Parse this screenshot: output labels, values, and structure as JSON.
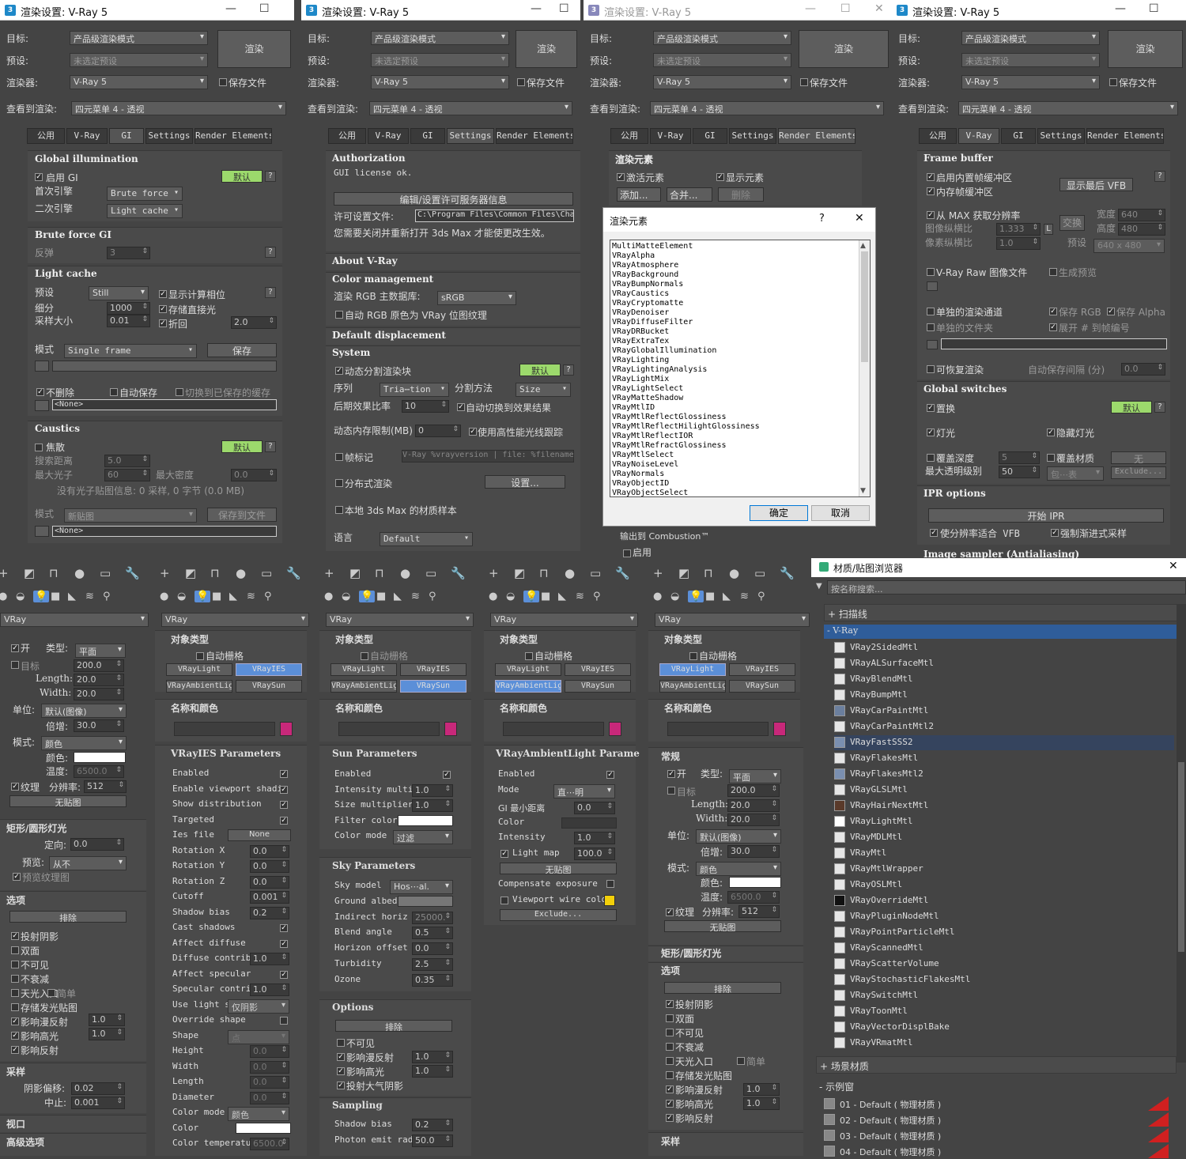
{
  "windows": [
    {
      "title": "渲染设置: V-Ray 5",
      "target_label": "目标:",
      "target": "产品级渲染模式",
      "preset_label": "预设:",
      "preset": "未选定预设",
      "renderer_label": "渲染器:",
      "renderer": "V-Ray 5",
      "save_file": "保存文件",
      "view_label": "查看到渲染:",
      "view": "四元菜单 4 - 透视",
      "render_btn": "渲染"
    }
  ],
  "tabs": [
    "公用",
    "V-Ray",
    "GI",
    "Settings",
    "Render Elements"
  ],
  "gi": {
    "global_title": "Global illumination",
    "enable_gi": "启用 GI",
    "default_btn": "默认",
    "primary": "首次引擎",
    "primary_val": "Brute force",
    "secondary": "二次引擎",
    "secondary_val": "Light cache",
    "bf_title": "Brute force GI",
    "bounces": "反弹",
    "bounces_val": "3",
    "lc_title": "Light cache",
    "preset": "预设",
    "preset_val": "Still",
    "show_phase": "显示计算相位",
    "subdiv": "细分",
    "subdiv_val": "1000",
    "store_direct": "存储直接光",
    "sample_size": "采样大小",
    "sample_val": "0.01",
    "retrace": "折回",
    "retrace_val": "2.0",
    "mode": "模式",
    "mode_val": "Single frame",
    "save": "保存",
    "dont_delete": "不删除",
    "auto_save": "自动保存",
    "switch_saved": "切换到已保存的缓存",
    "none": "<None>",
    "caustics_title": "Caustics",
    "focus": "焦散",
    "search_dist": "搜索距离",
    "search_val": "5.0",
    "max_photons": "最大光子",
    "max_photons_val": "60",
    "max_density": "最大密度",
    "max_density_val": "0.0",
    "no_map": "没有光子贴图信息: 0 采样, 0 字节 (0.0 MB)",
    "mode2": "模式",
    "new_map": "新贴图",
    "save_file": "保存到文件",
    "none2": "<None>"
  },
  "settings": {
    "auth_title": "Authorization",
    "license_ok": "GUI license ok.",
    "edit_license": "编辑/设置许可服务器信息",
    "license_file": "许可设置文件:",
    "license_path": "C:\\Program Files\\Common Files\\Cha",
    "restart_note": "您需要关闭并重新打开 3ds Max 才能使更改生效。",
    "about": "About V-Ray",
    "color_mgmt": "Color management",
    "rgb_label": "渲染 RGB 主数据库:",
    "rgb_val": "sRGB",
    "auto_rgb": "自动 RGB 原色为 VRay 位图纹理",
    "default_disp": "Default displacement",
    "system": "System",
    "dyn_split": "动态分割渲染块",
    "default_btn": "默认",
    "seq": "序列",
    "seq_val": "Tria⋯tion",
    "split_method": "分割方法",
    "split_val": "Size",
    "post_ratio": "后期效果比率",
    "post_val": "10",
    "auto_switch": "自动切换到效果结果",
    "dyn_mem": "动态内存限制(MB)",
    "dyn_mem_val": "0",
    "use_hp": "使用高性能光线跟踪",
    "frame_stamp": "帧标记",
    "stamp_val": "V-Ray %vrayversion | file: %filename",
    "dist_render": "分布式渲染",
    "setup": "设置...",
    "local_mat": "本地 3ds Max 的材质样本",
    "lang": "语言",
    "lang_val": "Default"
  },
  "elements": {
    "title": "渲染元素",
    "active": "激活元素",
    "show": "显示元素",
    "add": "添加...",
    "merge": "合并...",
    "delete": "删除",
    "output_combustion": "输出到 Combustion™",
    "enable": "启用",
    "dialog_title": "渲染元素",
    "dialog_q": "?",
    "ok": "确定",
    "cancel": "取消",
    "list": [
      "MultiMatteElement",
      "VRayAlpha",
      "VRayAtmosphere",
      "VRayBackground",
      "VRayBumpNormals",
      "VRayCaustics",
      "VRayCryptomatte",
      "VRayDenoiser",
      "VRayDiffuseFilter",
      "VRayDRBucket",
      "VRayExtraTex",
      "VRayGlobalIllumination",
      "VRayLighting",
      "VRayLightingAnalysis",
      "VRayLightMix",
      "VRayLightSelect",
      "VRayMatteShadow",
      "VRayMtlID",
      "VRayMtlReflectGlossiness",
      "VRayMtlReflectHilightGlossiness",
      "VRayMtlReflectIOR",
      "VRayMtlRefractGlossiness",
      "VRayMtlSelect",
      "VRayNoiseLevel",
      "VRayNormals",
      "VRayObjectID",
      "VRayObjectSelect"
    ]
  },
  "vray": {
    "fb_title": "Frame buffer",
    "builtin_fb": "启用内置帧缓冲区",
    "mem_fb": "内存帧缓冲区",
    "show_last": "显示最后 VFB",
    "from_max": "从 MAX 获取分辨率",
    "swap": "交换",
    "width": "宽度",
    "width_val": "640",
    "aspect": "图像纵横比",
    "aspect_val": "1.333",
    "height": "高度",
    "height_val": "480",
    "pixel_aspect": "像素纵横比",
    "pixel_val": "1.0",
    "preset": "预设",
    "preset_val": "640 x 480",
    "raw": "V-Ray Raw 图像文件",
    "gen_preview": "生成预览",
    "sep_channels": "单独的渲染通道",
    "save_rgb": "保存 RGB",
    "save_alpha": "保存 Alpha",
    "sep_folder": "单独的文件夹",
    "expand": "展开 # 到帧编号",
    "resumable": "可恢复渲染",
    "auto_save": "自动保存间隔 (分)",
    "auto_val": "0.0",
    "gs_title": "Global switches",
    "displace": "置换",
    "default_btn": "默认",
    "lights": "灯光",
    "hidden_lights": "隐藏灯光",
    "override_depth": "覆盖深度",
    "depth_val": "5",
    "override_mtl": "覆盖材质",
    "none": "无",
    "max_transp": "最大透明级别",
    "transp_val": "50",
    "include": "包⋯表",
    "exclude": "Exclude...",
    "ipr_title": "IPR options",
    "start_ipr": "开始 IPR",
    "fit_vfb": "使分辨率适合 VFB",
    "force_prog": "强制渐进式采样",
    "img_sampler": "Image sampler (Antialiasing)"
  },
  "cmd": {
    "dropdown": "VRay",
    "obj_type": "对象类型",
    "auto_grid": "自动栅格",
    "vlight": "VRayLight",
    "vies": "VRayIES",
    "vambient": "VRayAmbientLight",
    "vsun": "VRaySun",
    "name_color": "名称和颜色"
  },
  "light_props": {
    "on": "开",
    "type": "类型:",
    "type_val": "平面",
    "target": "目标",
    "target_val": "200.0",
    "length": "Length:",
    "length_val": "20.0",
    "width": "Width:",
    "width_val": "20.0",
    "unit": "单位:",
    "unit_val": "默认(图像)",
    "mult": "倍增:",
    "mult_val": "30.0",
    "mode": "模式:",
    "mode_val": "颜色",
    "color": "颜色:",
    "temp": "温度:",
    "temp_val": "6500.0",
    "texture": "纹理",
    "res": "分辨率:",
    "res_val": "512",
    "no_map": "无贴图",
    "rect": "矩形/圆形灯光",
    "direct": "定向:",
    "direct_val": "0.0",
    "preview": "预览:",
    "preview_val": "从不",
    "preview_tex": "预览纹理图",
    "options": "选项",
    "exclude": "排除",
    "cast_shadow": "投射阴影",
    "double": "双面",
    "invisible": "不可见",
    "no_decay": "不衰减",
    "skylight": "天光入口",
    "simple": "简单",
    "store_irr": "存储发光贴图",
    "aff_diff": "影响漫反射",
    "aff_diff_val": "1.0",
    "aff_spec": "影响高光",
    "aff_spec_val": "1.0",
    "aff_refl": "影响反射",
    "sampling": "采样",
    "shadow_bias": "阴影偏移:",
    "shadow_bias_val": "0.02",
    "cutoff": "中止:",
    "cutoff_val": "0.001",
    "viewport": "视口",
    "advanced": "高级选项",
    "general": "常规"
  },
  "ies": {
    "title": "VRayIES Parameters",
    "rows": [
      [
        "Enabled",
        ""
      ],
      [
        "Enable viewport shadin",
        ""
      ],
      [
        "Show distribution",
        ""
      ],
      [
        "Targeted",
        ""
      ],
      [
        "Ies file",
        ""
      ],
      [
        "Rotation X",
        "0.0"
      ],
      [
        "Rotation Y",
        "0.0"
      ],
      [
        "Rotation Z",
        "0.0"
      ],
      [
        "Cutoff",
        "0.001"
      ],
      [
        "Shadow bias",
        "0.2"
      ],
      [
        "Cast shadows",
        ""
      ],
      [
        "Affect diffuse",
        ""
      ],
      [
        "Diffuse contribu",
        "1.0"
      ],
      [
        "Affect specular",
        ""
      ],
      [
        "Specular contrib",
        "1.0"
      ],
      [
        "Use light s",
        "仅阴影"
      ],
      [
        "Override shape",
        ""
      ],
      [
        "Shape",
        "点"
      ],
      [
        "Height",
        "0.0"
      ],
      [
        "Width",
        "0.0"
      ],
      [
        "Length",
        "0.0"
      ],
      [
        "Diameter",
        "0.0"
      ],
      [
        "Color mode",
        "颜色"
      ],
      [
        "Color",
        ""
      ],
      [
        "Color temperatu",
        "6500.0"
      ]
    ],
    "none": "None"
  },
  "sun": {
    "title": "Sun Parameters",
    "rows": [
      [
        "Enabled",
        ""
      ],
      [
        "Intensity multip",
        "1.0"
      ],
      [
        "Size multiplier",
        "1.0"
      ],
      [
        "Filter color",
        ""
      ],
      [
        "Color mode",
        "过滤"
      ]
    ],
    "sky_title": "Sky Parameters",
    "sky_rows": [
      [
        "Sky model",
        "Hos⋯al."
      ],
      [
        "Ground albedo",
        ""
      ],
      [
        "Indirect horiz i",
        "25000."
      ],
      [
        "Blend angle",
        "0.5"
      ],
      [
        "Horizon offset",
        "0.0"
      ],
      [
        "Turbidity",
        "2.5"
      ],
      [
        "Ozone",
        "0.35"
      ]
    ],
    "opt_title": "Options",
    "exclude": "排除",
    "invisible": "不可见",
    "aff_diff": "影响漫反射",
    "aff_spec": "影响高光",
    "atmo": "投射大气阴影",
    "one": "1.0",
    "samp_title": "Sampling",
    "shadow_bias": "Shadow bias",
    "shadow_val": "0.2",
    "photon": "Photon emit radi",
    "photon_val": "50.0"
  },
  "ambient": {
    "title": "VRayAmbientLight Parame",
    "enabled": "Enabled",
    "mode": "Mode",
    "mode_val": "直⋯明",
    "gi_min": "GI 最小距离",
    "gi_val": "0.0",
    "color": "Color",
    "intensity": "Intensity",
    "int_val": "1.0",
    "lightmap": "Light map",
    "lm_val": "100.0",
    "nomap": "无贴图",
    "comp": "Compensate exposure",
    "vp_wire": "Viewport wire color",
    "exclude": "Exclude..."
  },
  "browser": {
    "title": "材质/贴图浏览器",
    "search": "按名称搜索...",
    "scanline": "+ 扫描线",
    "vray": "- V-Ray",
    "scene": "+ 场景材质",
    "samples": "- 示例窗",
    "mats": [
      "VRay2SidedMtl",
      "VRayALSurfaceMtl",
      "VRayBlendMtl",
      "VRayBumpMtl",
      "VRayCarPaintMtl",
      "VRayCarPaintMtl2",
      "VRayFastSSS2",
      "VRayFlakesMtl",
      "VRayFlakesMtl2",
      "VRayGLSLMtl",
      "VRayHairNextMtl",
      "VRayLightMtl",
      "VRayMDLMtl",
      "VRayMtl",
      "VRayMtlWrapper",
      "VRayOSLMtl",
      "VRayOverrideMtl",
      "VRayPluginNodeMtl",
      "VRayPointParticleMtl",
      "VRayScannedMtl",
      "VRayScatterVolume",
      "VRayStochasticFlakesMtl",
      "VRaySwitchMtl",
      "VRayToonMtl",
      "VRayVectorDisplBake",
      "VRayVRmatMtl"
    ],
    "samples_list": [
      "01 - Default  ( 物理材质 )",
      "02 - Default  ( 物理材质 )",
      "03 - Default  ( 物理材质 )",
      "04 - Default  ( 物理材质 )"
    ]
  }
}
